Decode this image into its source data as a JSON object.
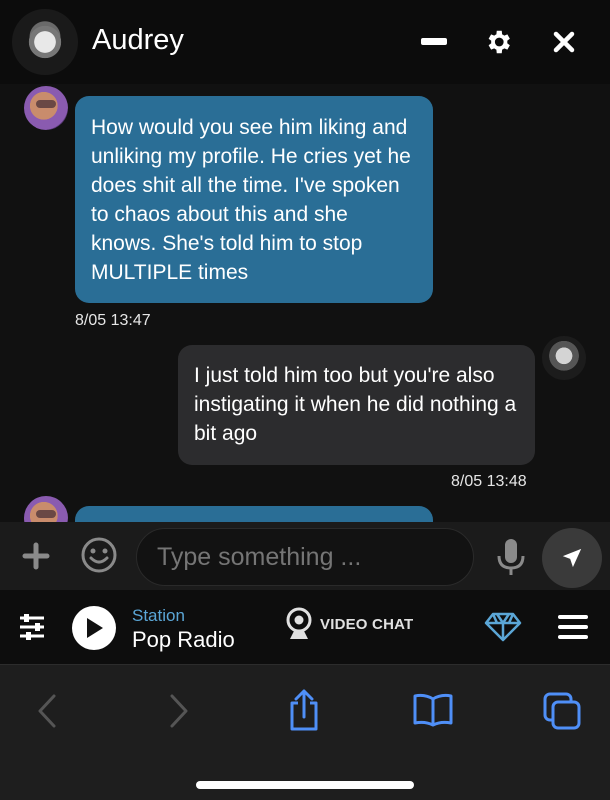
{
  "header": {
    "contact_name": "Audrey",
    "avatar_icon": "profile-photo",
    "minimize_icon": "minus-icon",
    "settings_icon": "gear-icon",
    "close_icon": "close-icon"
  },
  "messages": [
    {
      "direction": "incoming",
      "text": "How would you see him liking and unliking my profile. He cries yet he does shit all the time. I've spoken to chaos about this and she knows. She's told him to stop MULTIPLE times",
      "timestamp": "8/05 13:47"
    },
    {
      "direction": "outgoing",
      "text": "I just told him too but you're also instigating it when he did nothing a bit ago",
      "timestamp": "8/05 13:48"
    },
    {
      "direction": "incoming",
      "text": "",
      "timestamp": ""
    }
  ],
  "composer": {
    "placeholder": "Type something ...",
    "value": ""
  },
  "radio": {
    "station_label": "Station",
    "station_name": "Pop Radio",
    "video_chat_label": "VIDEO CHAT"
  },
  "colors": {
    "incoming_bubble": "#2a6e96",
    "outgoing_bubble": "#2c2c2e",
    "accent_blue": "#5ba6d6",
    "toolbar_icon_blue": "#4f8ff7"
  }
}
